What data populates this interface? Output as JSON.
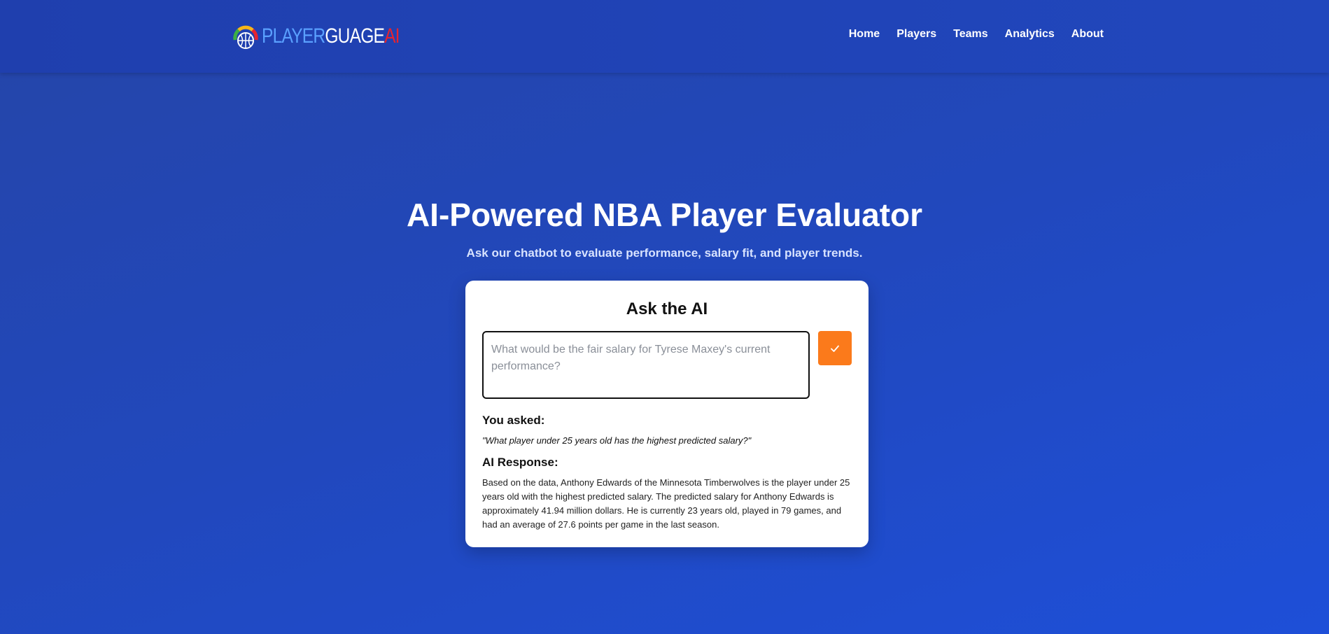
{
  "brand": {
    "part1": "PLAYER",
    "part2": "GUAGE",
    "part3": "AI",
    "colors": {
      "player": "#5aa0ff",
      "guage": "#ffffff",
      "ai": "#e8232e"
    },
    "icon": "gauge-basketball-icon"
  },
  "nav": {
    "items": [
      {
        "label": "Home"
      },
      {
        "label": "Players"
      },
      {
        "label": "Teams"
      },
      {
        "label": "Analytics"
      },
      {
        "label": "About"
      }
    ]
  },
  "hero": {
    "title": "AI-Powered NBA Player Evaluator",
    "subtitle": "Ask our chatbot to evaluate performance, salary fit, and player trends."
  },
  "chat": {
    "title": "Ask the AI",
    "input_value": "",
    "input_placeholder": "What would be the fair salary for Tyrese Maxey's current performance?",
    "submit_icon": "check-icon",
    "submit_color": "#fb7a1b",
    "asked_label": "You asked:",
    "asked_text": "\"What player under 25 years old has the highest predicted salary?\"",
    "response_label": "AI Response:",
    "response_text": "Based on the data, Anthony Edwards of the Minnesota Timberwolves is the player under 25 years old with the highest predicted salary. The predicted salary for Anthony Edwards is approximately 41.94 million dollars. He is currently 23 years old, played in 79 games, and had an average of 27.6 points per game in the last season."
  },
  "colors": {
    "background": "#2148bd",
    "card": "#ffffff",
    "accent": "#fb7a1b"
  }
}
